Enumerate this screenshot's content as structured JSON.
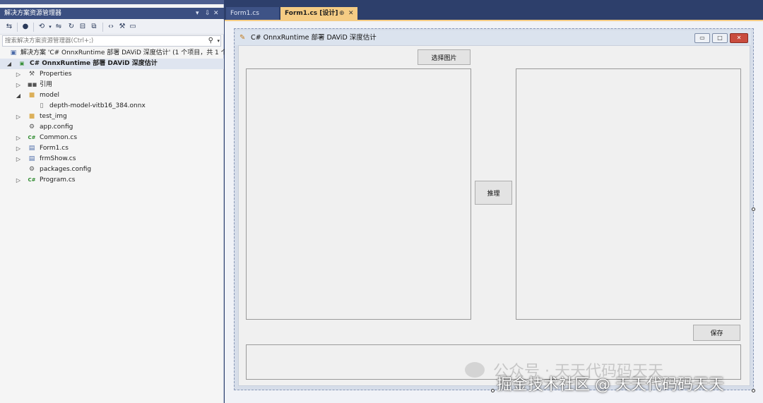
{
  "solution_explorer": {
    "title": "解决方案资源管理器",
    "title_controls": [
      "▾",
      "⇩",
      "✕"
    ],
    "search_placeholder": "搜索解决方案资源管理器(Ctrl+;)",
    "tree": [
      {
        "label": "解决方案 'C# OnnxRuntime 部署 DAViD  深度估计' (1 个项目，共 1 个",
        "icon": "solution-icon",
        "level": 0,
        "expander": ""
      },
      {
        "label": "C# OnnxRuntime 部署 DAViD  深度估计",
        "icon": "csharp-project-icon",
        "level": 0,
        "expander": "◢",
        "bold": true
      },
      {
        "label": "Properties",
        "icon": "wrench-icon",
        "level": 1,
        "expander": "▷"
      },
      {
        "label": "引用",
        "icon": "references-icon",
        "level": 1,
        "expander": "▷"
      },
      {
        "label": "model",
        "icon": "folder-icon",
        "level": 1,
        "expander": "◢"
      },
      {
        "label": "depth-model-vitb16_384.onnx",
        "icon": "file-icon",
        "level": 2,
        "expander": ""
      },
      {
        "label": "test_img",
        "icon": "folder-icon",
        "level": 1,
        "expander": "▷"
      },
      {
        "label": "app.config",
        "icon": "config-file-icon",
        "level": 1,
        "expander": ""
      },
      {
        "label": "Common.cs",
        "icon": "csharp-file-icon",
        "level": 1,
        "expander": "▷"
      },
      {
        "label": "Form1.cs",
        "icon": "form-file-icon",
        "level": 1,
        "expander": "▷"
      },
      {
        "label": "frmShow.cs",
        "icon": "form-file-icon",
        "level": 1,
        "expander": "▷"
      },
      {
        "label": "packages.config",
        "icon": "config-file-icon",
        "level": 1,
        "expander": ""
      },
      {
        "label": "Program.cs",
        "icon": "csharp-file-icon",
        "level": 1,
        "expander": "▷"
      }
    ]
  },
  "tabs": [
    {
      "label": "Form1.cs",
      "active": false
    },
    {
      "label": "Form1.cs [设计]",
      "active": true,
      "pin": "⊕",
      "close": "✕"
    }
  ],
  "form": {
    "title": "C# OnnxRuntime 部署 DAViD  深度估计",
    "window_buttons": {
      "minimize": "▭",
      "maximize": "□",
      "close": "✕"
    },
    "select_button": "选择图片",
    "infer_button": "推理",
    "save_button": "保存"
  },
  "watermark": {
    "faint": "公众号 · 天天代码码天天",
    "main": "掘金技术社区 @ 天天代码码天天"
  },
  "colors": {
    "vs_title_bg": "#3b4f81",
    "active_tab": "#f5cc84",
    "form_bg": "#f0f0f0"
  }
}
